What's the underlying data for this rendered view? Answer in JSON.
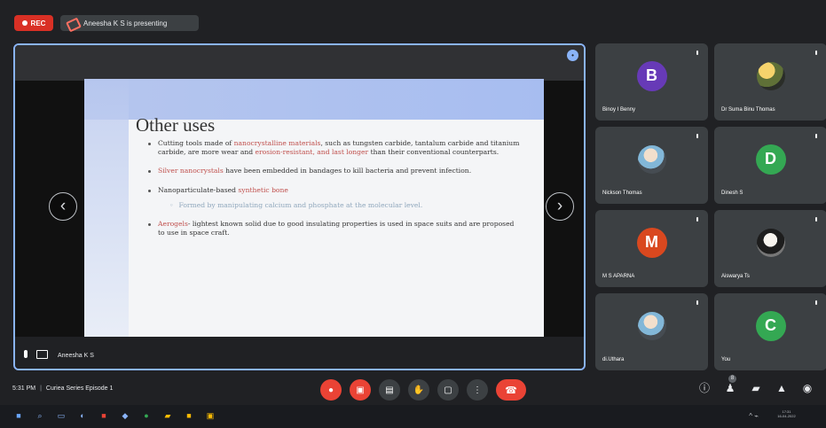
{
  "topbar": {
    "recording_label": "REC",
    "presenter_label": "Aneesha K S is presenting"
  },
  "presentation": {
    "slide_title": "Other uses",
    "bullets": [
      {
        "lead": "Cutting tools made of ",
        "highlight": "nanocrystalline materials",
        "text": ", such as tungsten carbide, tantalum carbide and titanium carbide, are more wear and ",
        "highlight2": "erosion-resistant, and last longer",
        "text2": " than their conventional counterparts."
      },
      {
        "lead": "",
        "highlight": "Silver nanocrystals",
        "text": " have been embedded in bandages to kill bacteria and prevent infection.",
        "highlight2": "",
        "text2": ""
      },
      {
        "lead": "Nanoparticulate-based ",
        "highlight": "synthetic bone",
        "text": "",
        "highlight2": "",
        "text2": ""
      },
      {
        "lead": "",
        "highlight": "Aerogels",
        "text": "- lightest known solid due to good insulating properties is used in space suits and are proposed to use in space craft.",
        "highlight2": "",
        "text2": ""
      }
    ],
    "sub_bullet": "Formed by manipulating calcium and phosphate at the molecular level.",
    "presenter_name": "Aneesha K S",
    "left_arrow": "‹",
    "right_arrow": "›",
    "pin_icon": "•"
  },
  "participants": [
    {
      "name": "Binoy I Benny",
      "initial": "B",
      "color": "#673ab7",
      "photo": false,
      "mic_icon": "mic-muted-icon"
    },
    {
      "name": "Dr Suma Binu Thomas",
      "initial": "",
      "color": "#5f7037",
      "photo": true,
      "mic_icon": "mic-muted-icon"
    },
    {
      "name": "Nickson Thomas",
      "initial": "",
      "color": "#82b7d8",
      "photo": true,
      "mic_icon": "mic-muted-icon"
    },
    {
      "name": "Dinesh S",
      "initial": "D",
      "color": "#34a853",
      "photo": false,
      "mic_icon": "mic-muted-icon"
    },
    {
      "name": "M S APARNA",
      "initial": "M",
      "color": "#d9481f",
      "photo": false,
      "mic_icon": "mic-muted-icon"
    },
    {
      "name": "Aiswarya Ts",
      "initial": "",
      "color": "#1d1d1d",
      "photo": true,
      "mic_icon": "mic-muted-icon"
    },
    {
      "name": "di.Uthara",
      "initial": "",
      "color": "#82b7d8",
      "photo": true,
      "mic_icon": "mic-muted-icon"
    },
    {
      "name": "You",
      "initial": "C",
      "color": "#34a853",
      "photo": false,
      "mic_icon": "mic-muted-icon"
    }
  ],
  "bottom_bar": {
    "time": "5:31 PM",
    "meeting_title": "Curiea Series Episode 1",
    "controls": [
      {
        "icon": "mic-off-icon",
        "glyph": "●"
      },
      {
        "icon": "camera-off-icon",
        "glyph": "▣"
      },
      {
        "icon": "captions-icon",
        "glyph": "▤"
      },
      {
        "icon": "raise-hand-icon",
        "glyph": "✋"
      },
      {
        "icon": "present-icon",
        "glyph": "▢"
      },
      {
        "icon": "more-options-icon",
        "glyph": "⋮"
      }
    ],
    "end_call_icon": "☎",
    "right_tools": [
      {
        "icon": "info-icon",
        "glyph": "ⓘ"
      },
      {
        "icon": "people-icon",
        "glyph": "♟",
        "badge": "8"
      },
      {
        "icon": "chat-icon",
        "glyph": "▰"
      },
      {
        "icon": "activities-icon",
        "glyph": "▲"
      },
      {
        "icon": "lock-icon",
        "glyph": "◉"
      }
    ]
  },
  "taskbar": {
    "icons": [
      {
        "name": "windows-start-icon",
        "glyph": "■",
        "tone": "win"
      },
      {
        "name": "search-icon",
        "glyph": "⌕",
        "tone": ""
      },
      {
        "name": "task-view-icon",
        "glyph": "▭",
        "tone": ""
      },
      {
        "name": "edge-icon",
        "glyph": "◐",
        "tone": ""
      },
      {
        "name": "office-icon",
        "glyph": "■",
        "tone": "red"
      },
      {
        "name": "store-icon",
        "glyph": "◆",
        "tone": ""
      },
      {
        "name": "chrome-icon",
        "glyph": "●",
        "tone": "green"
      },
      {
        "name": "file-explorer-icon",
        "glyph": "▰",
        "tone": "yellow"
      },
      {
        "name": "app-icon",
        "glyph": "■",
        "tone": "yellow"
      },
      {
        "name": "notes-icon",
        "glyph": "▣",
        "tone": "yellow"
      }
    ],
    "tray_text": "^ ⌁",
    "clock_time": "17:31",
    "clock_date": "16-04-2022"
  }
}
